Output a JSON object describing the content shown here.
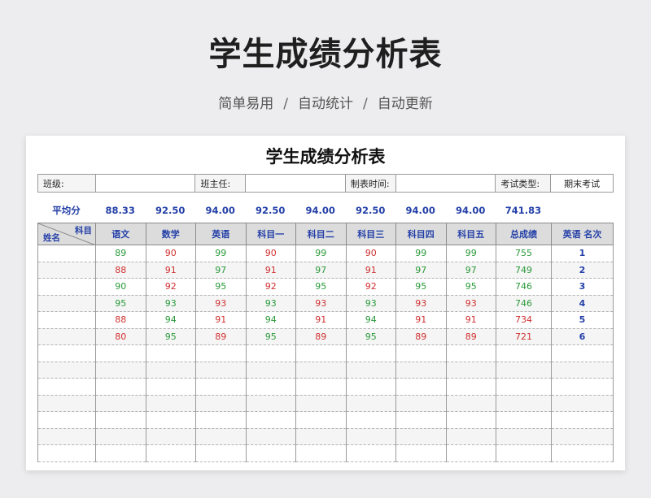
{
  "hero": {
    "title": "学生成绩分析表",
    "sub": [
      "简单易用",
      "自动统计",
      "自动更新"
    ],
    "separator": "/"
  },
  "sheet": {
    "title": "学生成绩分析表",
    "info": {
      "class_label": "班级:",
      "class_value": "",
      "teacher_label": "班主任:",
      "teacher_value": "",
      "date_label": "制表时间:",
      "date_value": "",
      "exam_type_label": "考试类型:",
      "exam_type_value": "期末考试"
    },
    "average": {
      "label": "平均分",
      "values": [
        "88.33",
        "92.50",
        "94.00",
        "92.50",
        "94.00",
        "92.50",
        "94.00",
        "94.00",
        "741.83"
      ]
    },
    "header": {
      "corner_top": "科目",
      "corner_bottom": "姓名",
      "columns": [
        "语文",
        "数学",
        "英语",
        "科目一",
        "科目二",
        "科目三",
        "科目四",
        "科目五",
        "总成绩",
        "英语 名次"
      ]
    },
    "rows": [
      {
        "name": "",
        "scores": [
          "89",
          "90",
          "99",
          "90",
          "99",
          "90",
          "99",
          "99"
        ],
        "total": "755",
        "rank": "1"
      },
      {
        "name": "",
        "scores": [
          "88",
          "91",
          "97",
          "91",
          "97",
          "91",
          "97",
          "97"
        ],
        "total": "749",
        "rank": "2"
      },
      {
        "name": "",
        "scores": [
          "90",
          "92",
          "95",
          "92",
          "95",
          "92",
          "95",
          "95"
        ],
        "total": "746",
        "rank": "3"
      },
      {
        "name": "",
        "scores": [
          "95",
          "93",
          "93",
          "93",
          "93",
          "93",
          "93",
          "93"
        ],
        "total": "746",
        "rank": "4"
      },
      {
        "name": "",
        "scores": [
          "88",
          "94",
          "91",
          "94",
          "91",
          "94",
          "91",
          "91"
        ],
        "total": "734",
        "rank": "5"
      },
      {
        "name": "",
        "scores": [
          "80",
          "95",
          "89",
          "95",
          "89",
          "95",
          "89",
          "89"
        ],
        "total": "721",
        "rank": "6"
      }
    ],
    "score_colors": [
      [
        "g",
        "r",
        "g",
        "r",
        "g",
        "r",
        "g",
        "g",
        "g"
      ],
      [
        "r",
        "r",
        "g",
        "r",
        "g",
        "r",
        "g",
        "g",
        "g"
      ],
      [
        "g",
        "r",
        "g",
        "r",
        "g",
        "r",
        "g",
        "g",
        "g"
      ],
      [
        "g",
        "g",
        "r",
        "g",
        "r",
        "g",
        "r",
        "r",
        "g"
      ],
      [
        "r",
        "g",
        "r",
        "g",
        "r",
        "g",
        "r",
        "r",
        "r"
      ],
      [
        "r",
        "g",
        "r",
        "g",
        "r",
        "g",
        "r",
        "r",
        "r"
      ]
    ],
    "empty_rows": 7,
    "colors": {
      "green": "#2a9a3a",
      "red": "#d03030",
      "blue": "#2440a8"
    }
  }
}
